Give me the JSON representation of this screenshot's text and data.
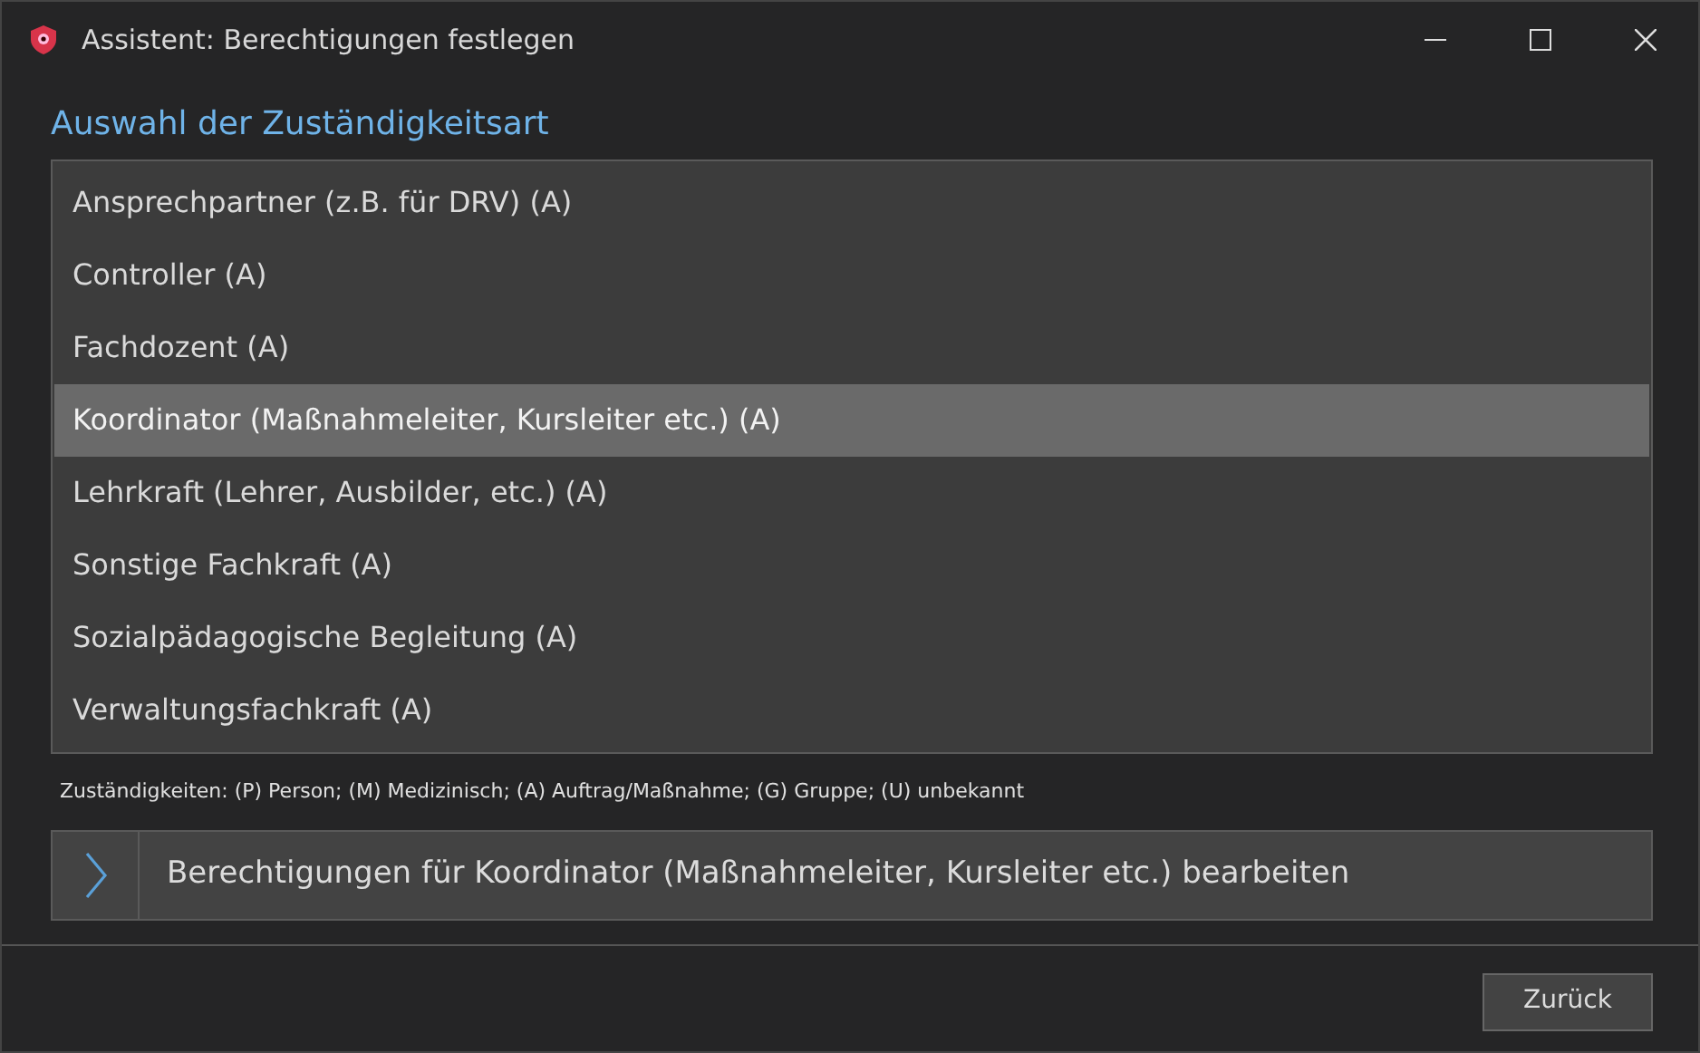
{
  "window": {
    "title": "Assistent: Berechtigungen festlegen"
  },
  "heading": "Auswahl der Zuständigkeitsart",
  "items": [
    {
      "label": "Ansprechpartner (z.B. für DRV) (A)",
      "selected": false
    },
    {
      "label": "Controller (A)",
      "selected": false
    },
    {
      "label": "Fachdozent (A)",
      "selected": false
    },
    {
      "label": "Koordinator (Maßnahmeleiter, Kursleiter etc.) (A)",
      "selected": true
    },
    {
      "label": "Lehrkraft (Lehrer, Ausbilder, etc.) (A)",
      "selected": false
    },
    {
      "label": "Sonstige Fachkraft (A)",
      "selected": false
    },
    {
      "label": "Sozialpädagogische Begleitung (A)",
      "selected": false
    },
    {
      "label": "Verwaltungsfachkraft (A)",
      "selected": false
    }
  ],
  "legend": "Zuständigkeiten: (P) Person; (M) Medizinisch; (A) Auftrag/Maßnahme; (G) Gruppe; (U) unbekannt",
  "action": {
    "label": "Berechtigungen für Koordinator (Maßnahmeleiter, Kursleiter etc.) bearbeiten"
  },
  "buttons": [
    "Zurück"
  ]
}
